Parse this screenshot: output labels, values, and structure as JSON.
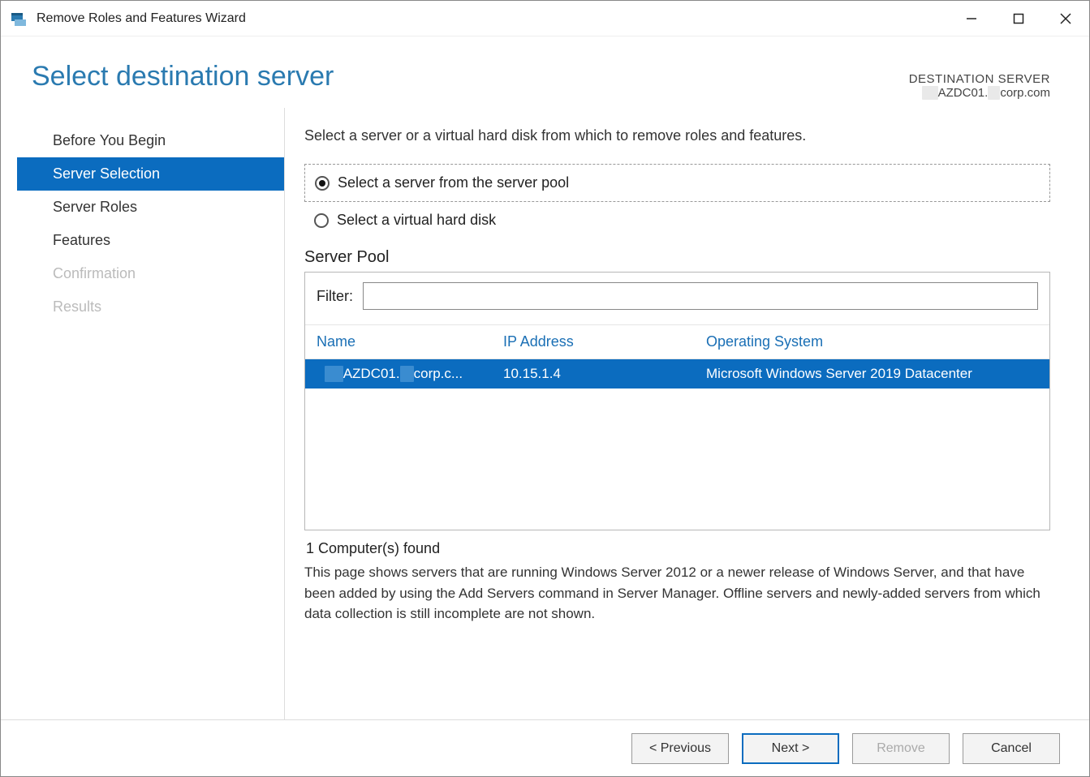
{
  "window": {
    "title": "Remove Roles and Features Wizard"
  },
  "page_title": "Select destination server",
  "destination": {
    "label": "DESTINATION SERVER",
    "value_prefix_redacted": "XX",
    "value_mid": "AZDC01.",
    "value_mid2_redacted": "xx",
    "value_suffix": "corp.com"
  },
  "steps": [
    {
      "label": "Before You Begin",
      "state": "normal"
    },
    {
      "label": "Server Selection",
      "state": "active"
    },
    {
      "label": "Server Roles",
      "state": "normal"
    },
    {
      "label": "Features",
      "state": "normal"
    },
    {
      "label": "Confirmation",
      "state": "disabled"
    },
    {
      "label": "Results",
      "state": "disabled"
    }
  ],
  "instruction": "Select a server or a virtual hard disk from which to remove roles and features.",
  "radios": {
    "pool": "Select a server from the server pool",
    "vhd": "Select a virtual hard disk"
  },
  "server_pool": {
    "label": "Server Pool",
    "filter_label": "Filter:",
    "filter_value": "",
    "columns": {
      "name": "Name",
      "ip": "IP Address",
      "os": "Operating System"
    },
    "rows": [
      {
        "name_prefix_redacted": "XX",
        "name_mid": "AZDC01.",
        "name_mid2_redacted": "xx",
        "name_suffix": "corp.c...",
        "ip": "10.15.1.4",
        "os": "Microsoft Windows Server 2019 Datacenter",
        "selected": true
      }
    ],
    "found": "1 Computer(s) found"
  },
  "description": "This page shows servers that are running Windows Server 2012 or a newer release of Windows Server, and that have been added by using the Add Servers command in Server Manager. Offline servers and newly-added servers from which data collection is still incomplete are not shown.",
  "footer": {
    "previous": "< Previous",
    "next": "Next >",
    "remove": "Remove",
    "cancel": "Cancel"
  }
}
